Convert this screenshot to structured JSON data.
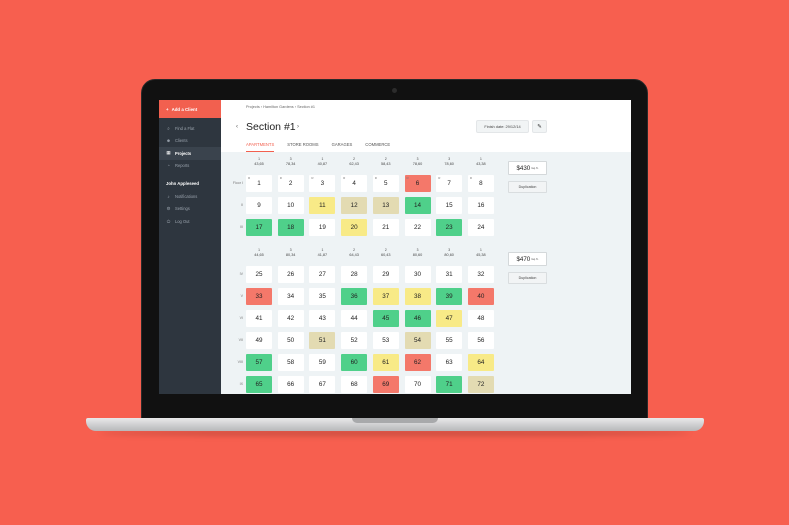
{
  "sidebar": {
    "add_client": "Add a Client",
    "nav": [
      {
        "label": "Find a Flat",
        "icon": "search-icon"
      },
      {
        "label": "Clients",
        "icon": "users-icon"
      },
      {
        "label": "Projects",
        "icon": "grid-icon",
        "active": true
      },
      {
        "label": "Reports",
        "icon": "chart-icon"
      }
    ],
    "user_name": "John Appleseed",
    "user_nav": [
      {
        "label": "Notifications",
        "icon": "bell-icon"
      },
      {
        "label": "Settings",
        "icon": "gear-icon"
      },
      {
        "label": "Log Out",
        "icon": "logout-icon"
      }
    ]
  },
  "header": {
    "breadcrumb": "Projects  ›  Hamilton Gardens  ›  Section #1",
    "title": "Section #1",
    "finish_date": "Finish date: 29/12/14"
  },
  "tabs": [
    "APARTMENTS",
    "STORE ROOMS",
    "GARAGES",
    "COMMERCE"
  ],
  "sections": [
    {
      "columns": [
        {
          "n": "1",
          "area": "43,65"
        },
        {
          "n": "3",
          "area": "78,34"
        },
        {
          "n": "1",
          "area": "40,87"
        },
        {
          "n": "2",
          "area": "62,43"
        },
        {
          "n": "2",
          "area": "58,43"
        },
        {
          "n": "3",
          "area": "78,60"
        },
        {
          "n": "3",
          "area": "78,60"
        },
        {
          "n": "1",
          "area": "43,38"
        }
      ],
      "price": "$430",
      "price_unit": "/sq.ft.",
      "duplicate_label": "Duplication",
      "rows": [
        {
          "label": "Floor I",
          "cells": [
            {
              "v": "1",
              "c": "R"
            },
            {
              "v": "2",
              "c": "R"
            },
            {
              "v": "3",
              "c": "R"
            },
            {
              "v": "4",
              "c": "R"
            },
            {
              "v": "5",
              "c": "R"
            },
            {
              "v": "6",
              "c": "R",
              "s": "red"
            },
            {
              "v": "7",
              "c": "R"
            },
            {
              "v": "8",
              "c": "R"
            }
          ]
        },
        {
          "label": "II",
          "cells": [
            {
              "v": "9"
            },
            {
              "v": "10"
            },
            {
              "v": "11",
              "s": "yellow"
            },
            {
              "v": "12",
              "s": "beige"
            },
            {
              "v": "13",
              "s": "beige"
            },
            {
              "v": "14",
              "s": "green"
            },
            {
              "v": "15"
            },
            {
              "v": "16"
            }
          ]
        },
        {
          "label": "III",
          "cells": [
            {
              "v": "17",
              "s": "green"
            },
            {
              "v": "18",
              "s": "green"
            },
            {
              "v": "19"
            },
            {
              "v": "20",
              "s": "yellow"
            },
            {
              "v": "21"
            },
            {
              "v": "22"
            },
            {
              "v": "23",
              "s": "green"
            },
            {
              "v": "24"
            }
          ]
        }
      ]
    },
    {
      "columns": [
        {
          "n": "1",
          "area": "44,65"
        },
        {
          "n": "3",
          "area": "80,34"
        },
        {
          "n": "1",
          "area": "41,87"
        },
        {
          "n": "2",
          "area": "64,43"
        },
        {
          "n": "2",
          "area": "60,43"
        },
        {
          "n": "3",
          "area": "80,60"
        },
        {
          "n": "3",
          "area": "80,60"
        },
        {
          "n": "1",
          "area": "45,38"
        }
      ],
      "price": "$470",
      "price_unit": "/sq.ft.",
      "duplicate_label": "Duplication",
      "rows": [
        {
          "label": "IV",
          "cells": [
            {
              "v": "25"
            },
            {
              "v": "26"
            },
            {
              "v": "27"
            },
            {
              "v": "28"
            },
            {
              "v": "29"
            },
            {
              "v": "30"
            },
            {
              "v": "31"
            },
            {
              "v": "32"
            }
          ]
        },
        {
          "label": "V",
          "cells": [
            {
              "v": "33",
              "s": "red"
            },
            {
              "v": "34"
            },
            {
              "v": "35"
            },
            {
              "v": "36",
              "s": "green"
            },
            {
              "v": "37",
              "s": "yellow"
            },
            {
              "v": "38",
              "s": "yellow"
            },
            {
              "v": "39",
              "s": "green"
            },
            {
              "v": "40",
              "s": "red"
            }
          ]
        },
        {
          "label": "VI",
          "cells": [
            {
              "v": "41"
            },
            {
              "v": "42"
            },
            {
              "v": "43"
            },
            {
              "v": "44"
            },
            {
              "v": "45",
              "s": "green"
            },
            {
              "v": "46",
              "s": "green"
            },
            {
              "v": "47",
              "s": "yellow"
            },
            {
              "v": "48"
            }
          ]
        },
        {
          "label": "VII",
          "cells": [
            {
              "v": "49"
            },
            {
              "v": "50"
            },
            {
              "v": "51",
              "s": "beige"
            },
            {
              "v": "52"
            },
            {
              "v": "53"
            },
            {
              "v": "54",
              "s": "beige"
            },
            {
              "v": "55"
            },
            {
              "v": "56"
            }
          ]
        },
        {
          "label": "VIII",
          "cells": [
            {
              "v": "57",
              "s": "green"
            },
            {
              "v": "58"
            },
            {
              "v": "59"
            },
            {
              "v": "60",
              "s": "green"
            },
            {
              "v": "61",
              "s": "yellow"
            },
            {
              "v": "62",
              "s": "red"
            },
            {
              "v": "63"
            },
            {
              "v": "64",
              "s": "yellow"
            }
          ]
        },
        {
          "label": "IX",
          "cells": [
            {
              "v": "65",
              "s": "green"
            },
            {
              "v": "66"
            },
            {
              "v": "67"
            },
            {
              "v": "68"
            },
            {
              "v": "69",
              "s": "red"
            },
            {
              "v": "70"
            },
            {
              "v": "71",
              "s": "green"
            },
            {
              "v": "72",
              "s": "beige"
            }
          ]
        }
      ]
    }
  ],
  "colors": {
    "accent": "#f2604f",
    "available": "#4fd08a",
    "reserved": "#f8ea87",
    "pending": "#e3dbb2",
    "sold": "#f4786a"
  }
}
